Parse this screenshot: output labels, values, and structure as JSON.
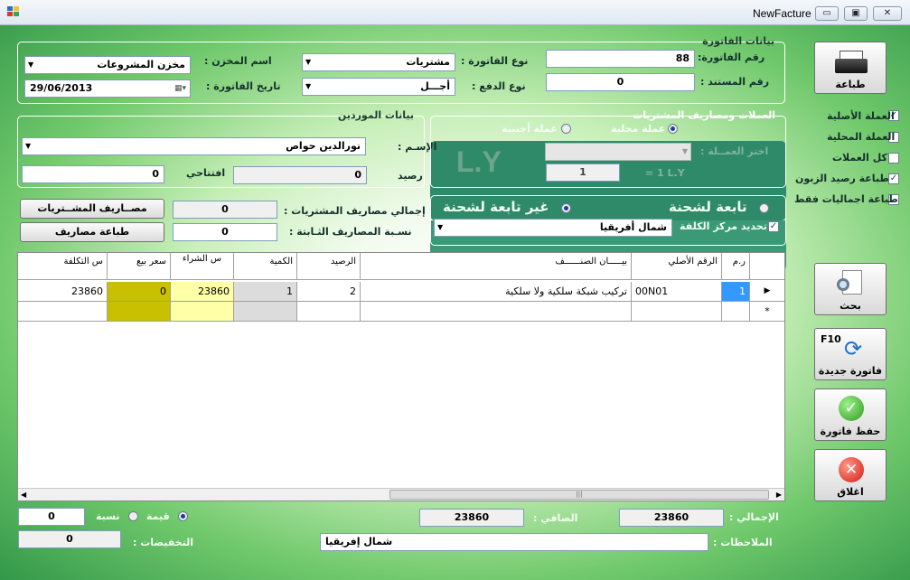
{
  "window": {
    "title": "NewFacture",
    "btn_min": "▭",
    "btn_max": "▣",
    "btn_close": "✕"
  },
  "invoice": {
    "group_title": "بيانات الفاتورة",
    "number_label": "رقم الفاتورة:",
    "number_value": "88",
    "type_label": "نوع الفاتورة :",
    "type_value": "مشتريات",
    "store_label": "اسم المخزن :",
    "store_value": "مخزن المشروعات",
    "doc_label": "رقم المستند :",
    "doc_value": "0",
    "pay_label": "نوع الدفع :",
    "pay_value": "أجـــل",
    "date_label": "تاريخ الفاتورة :",
    "date_value": "29/06/2013"
  },
  "suppliers": {
    "group_title": "بيانات الموردين",
    "name_label": "الإسـم :",
    "name_value": "نورالدين حواص",
    "balance_label": "رصيد",
    "balance_value": "0",
    "opening_label": "افتتاحي",
    "opening_value": "0"
  },
  "currency": {
    "group_title": "العملات ومصاريف المشتريات",
    "local_label": "عملة محلية",
    "foreign_label": "عملة أجنبية",
    "choose_label": "اختر العمــلة :",
    "choose_value": "",
    "symbol": "L.Y",
    "rate_value": "1",
    "rate_text": "= 1 L.Y"
  },
  "expenses": {
    "total_label": "إجمالي مصاريف المشتريات :",
    "total_value": "0",
    "fixed_label": "نسـبة المصاريف الثـابتة :",
    "fixed_value": "0",
    "btn_expenses": "مصــاريف المشــتريات",
    "btn_print_expenses": "طباعة مصاريف"
  },
  "shipment": {
    "attached_label": "تابعة لشحنة",
    "not_attached_label": "غير تابعة لشحنة",
    "cost_center_label": "تحديد مركز الكلفة",
    "cost_center_checked": "✓",
    "cost_center_value": "شمال أفريقيا"
  },
  "right_options": [
    {
      "label": "العملة الأصلية",
      "mark": "✓"
    },
    {
      "label": "العملة المحلية",
      "mark": ""
    },
    {
      "label": "كل العملات",
      "mark": ""
    },
    {
      "label": "طباعة رصيد الزبون",
      "mark": "✓"
    },
    {
      "label": "طباعة اجماليات فقط",
      "mark": ""
    }
  ],
  "buttons": {
    "print": "طباعة",
    "search": "بحث",
    "new_invoice": "فاتورة جديدة",
    "new_invoice_key": "F10",
    "save": "حفظ فاتورة",
    "close": "اغلاق"
  },
  "grid": {
    "columns": [
      "ر.م",
      "الرقم الأصلي",
      "بيـــــان الصنــــــف",
      "الرصيد",
      "الكمية",
      "س الشراء",
      "سعر بيع",
      "س التكلفة"
    ],
    "rows": [
      {
        "marker": "▶",
        "rm": "1",
        "code": "00N01",
        "desc": "تركيب شبكة سلكية ولا سلكية",
        "balance": "2",
        "qty": "1",
        "buy": "23860",
        "sell": "0",
        "cost": "23860"
      }
    ],
    "new_row_marker": "*",
    "scroll_grip": "|||"
  },
  "footer": {
    "total_label": "الإجمالي :",
    "total_value": "23860",
    "net_label": "الصافي :",
    "net_value": "23860",
    "value_label": "قيمة",
    "percent_label": "نسبة",
    "discount_input": "0",
    "discounts_label": "التخفيضات :",
    "discounts_value": "0",
    "notes_label": "الملاحظات :",
    "notes_value": "شمال إفريقيا"
  },
  "colors": {
    "yellow": "#ffffa8",
    "olive": "#c8c000",
    "gray_cell": "#dcdcdc",
    "blue_sel": "#3399ff"
  }
}
